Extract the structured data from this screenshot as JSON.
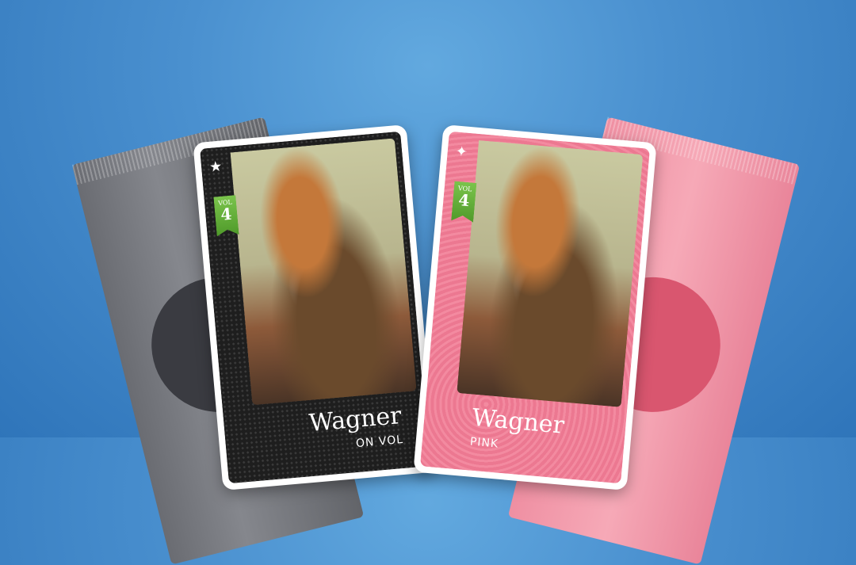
{
  "colors": {
    "background": "#4a90cf",
    "pack_gray": "#75777d",
    "pack_pink": "#f29bae",
    "card_pink": "#ef7f96",
    "card_carbon": "#1e1e1e",
    "vol_ribbon": "#5fae35"
  },
  "cards": [
    {
      "icon": "star-icon",
      "icon_glyph": "★",
      "vol_label": "VOL",
      "vol_number": "4",
      "name": "Wagner",
      "subtitle": "ON VOL"
    },
    {
      "icon": "sparkle-icon",
      "icon_glyph": "✦",
      "vol_label": "VOL",
      "vol_number": "4",
      "name": "Wagner",
      "subtitle": "PINK"
    }
  ]
}
